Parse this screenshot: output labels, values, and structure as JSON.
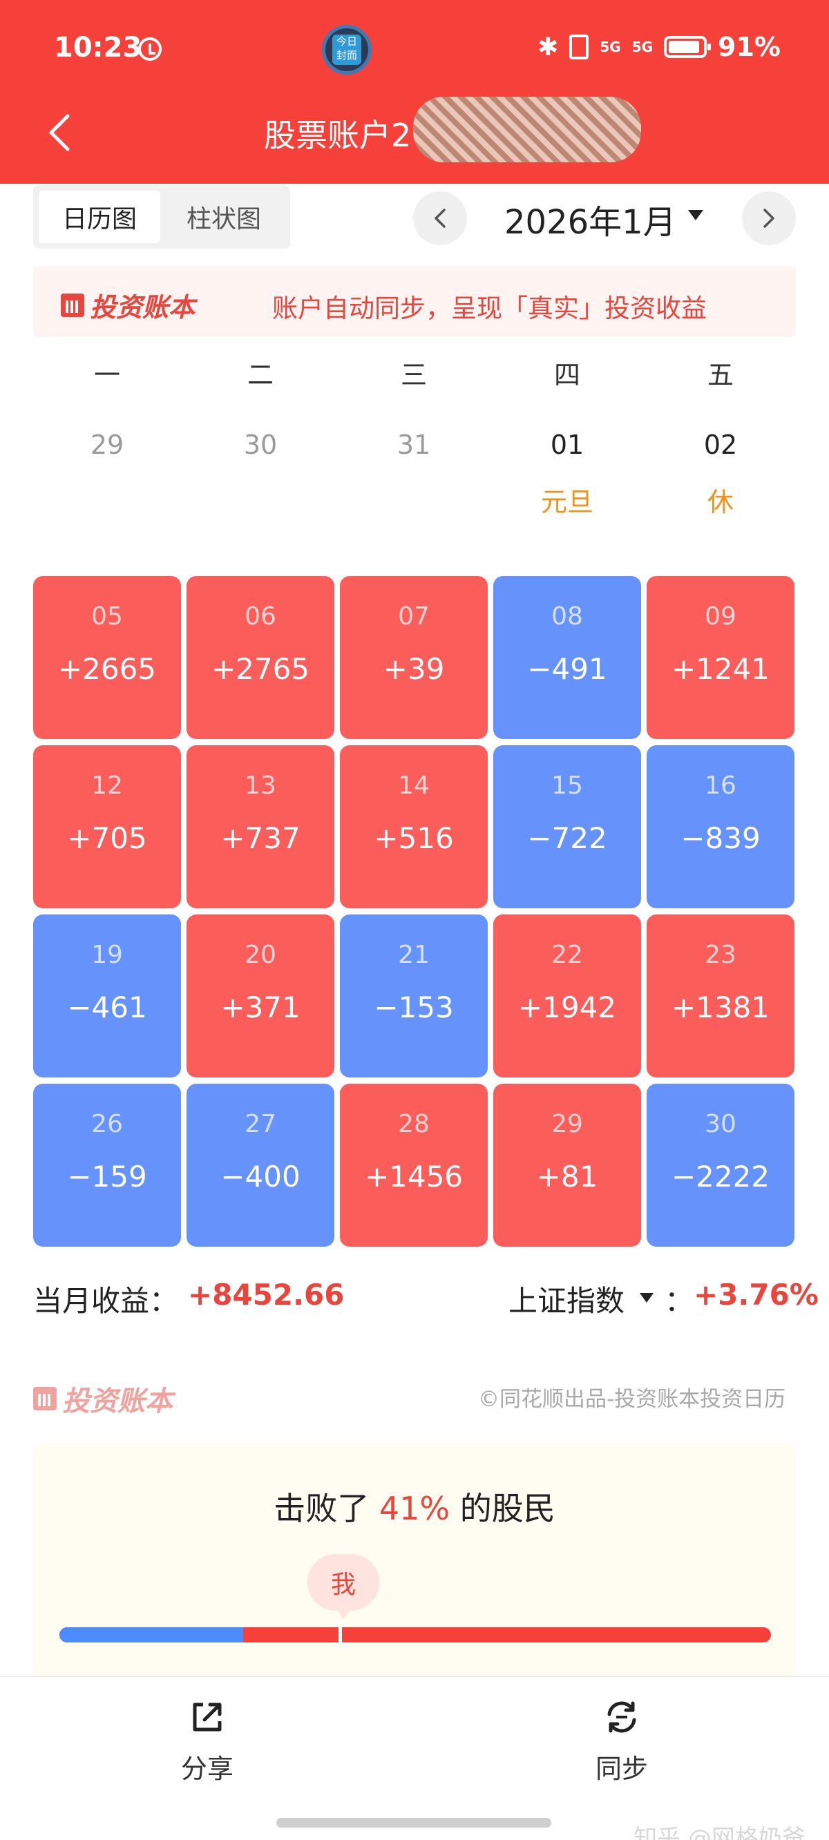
{
  "status_bar": {
    "time": "10:23",
    "badge_text": "今日封面",
    "signal_1": "5G",
    "signal_2": "5G",
    "battery": "91%"
  },
  "header": {
    "title": "股票账户2"
  },
  "toolbar": {
    "tabs": [
      {
        "label": "日历图",
        "active": true
      },
      {
        "label": "柱状图",
        "active": false
      }
    ],
    "month": "2026年1月"
  },
  "banner": {
    "logo": "投资账本",
    "text": "账户自动同步，呈现「真实」投资收益"
  },
  "calendar": {
    "weekdays": [
      "一",
      "二",
      "三",
      "四",
      "五"
    ],
    "first_row": [
      {
        "date": "29",
        "note": "",
        "in_month": false
      },
      {
        "date": "30",
        "note": "",
        "in_month": false
      },
      {
        "date": "31",
        "note": "",
        "in_month": false
      },
      {
        "date": "01",
        "note": "元旦",
        "in_month": true
      },
      {
        "date": "02",
        "note": "休",
        "in_month": true
      }
    ],
    "weeks": [
      [
        {
          "date": "05",
          "value": "+2665",
          "trend": "up"
        },
        {
          "date": "06",
          "value": "+2765",
          "trend": "up"
        },
        {
          "date": "07",
          "value": "+39",
          "trend": "up"
        },
        {
          "date": "08",
          "value": "−491",
          "trend": "down"
        },
        {
          "date": "09",
          "value": "+1241",
          "trend": "up"
        }
      ],
      [
        {
          "date": "12",
          "value": "+705",
          "trend": "up"
        },
        {
          "date": "13",
          "value": "+737",
          "trend": "up"
        },
        {
          "date": "14",
          "value": "+516",
          "trend": "up"
        },
        {
          "date": "15",
          "value": "−722",
          "trend": "down"
        },
        {
          "date": "16",
          "value": "−839",
          "trend": "down"
        }
      ],
      [
        {
          "date": "19",
          "value": "−461",
          "trend": "down"
        },
        {
          "date": "20",
          "value": "+371",
          "trend": "up"
        },
        {
          "date": "21",
          "value": "−153",
          "trend": "down"
        },
        {
          "date": "22",
          "value": "+1942",
          "trend": "up"
        },
        {
          "date": "23",
          "value": "+1381",
          "trend": "up"
        }
      ],
      [
        {
          "date": "26",
          "value": "−159",
          "trend": "down"
        },
        {
          "date": "27",
          "value": "−400",
          "trend": "down"
        },
        {
          "date": "28",
          "value": "+1456",
          "trend": "up"
        },
        {
          "date": "29",
          "value": "+81",
          "trend": "up"
        },
        {
          "date": "30",
          "value": "−2222",
          "trend": "down"
        }
      ]
    ]
  },
  "summary": {
    "month_label": "当月收益：",
    "month_value": "+8452.66",
    "index_label": "上证指数",
    "index_colon": "：",
    "index_value": "+3.76%"
  },
  "footer": {
    "logo": "投资账本",
    "credit": "©同花顺出品-投资账本投资日历"
  },
  "beat": {
    "prefix": "击败了 ",
    "percent": "41%",
    "suffix": " 的股民",
    "me_label": "我",
    "percent_value": 0.41
  },
  "bottom_bar": {
    "share_label": "分享",
    "sync_label": "同步"
  },
  "watermark": "知乎 @网格奶爸",
  "colors": {
    "header_red": "#f5413a",
    "gain_cell": "#fb5e5a",
    "loss_cell": "#6593fb",
    "accent_red": "#e8453c",
    "holiday_orange": "#f0931a"
  }
}
